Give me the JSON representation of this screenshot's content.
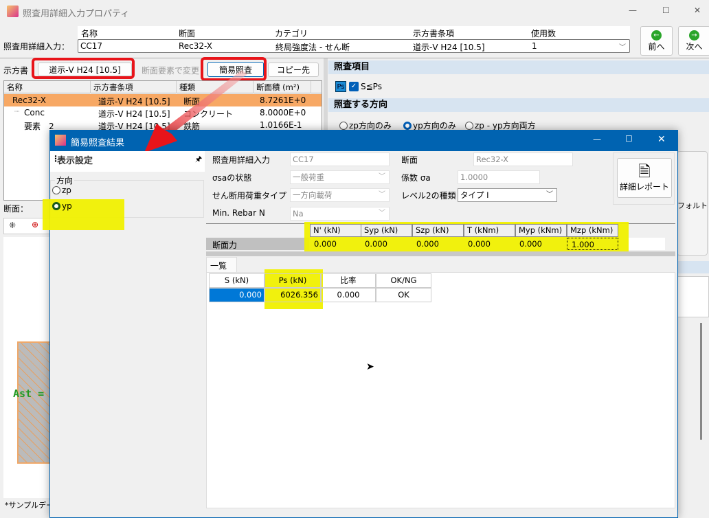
{
  "window": {
    "title": "照査用詳細入力プロパティ",
    "min": "—",
    "max": "☐",
    "close": "✕"
  },
  "header": {
    "label": "照査用詳細入力：",
    "columns": [
      "名称",
      "断面",
      "カテゴリ",
      "示方書条項",
      "使用数"
    ],
    "values": [
      "CC17",
      "Rec32-X",
      "終局強度法 - せん断",
      "道示-V H24 [10.5]",
      "1"
    ],
    "prev": "前へ",
    "next": "次へ"
  },
  "left": {
    "code_label": "示方書",
    "code_button": "道示-V H24 [10.5]",
    "change_label": "断面要素で変更",
    "simple_check": "簡易照査",
    "copy_to": "コピー先",
    "tree_columns": [
      "名称",
      "示方書条項",
      "種類",
      "断面積 (m²)"
    ],
    "tree_rows": [
      [
        "Rec32-X",
        "道示-V H24 [10.5]",
        "断面",
        "8.7261E+0"
      ],
      [
        "Conc",
        "道示-V H24 [10.5]",
        "コンクリート",
        "8.0000E+0"
      ],
      [
        "要素　2",
        "道示-V H24 [10.5]",
        "鉄筋",
        "1.0166E-1"
      ]
    ],
    "section_label": "断面：",
    "ast": "Ast =",
    "status": "*サンプルデータ"
  },
  "right": {
    "check_items": "照査項目",
    "ps_icon": "Ps",
    "ps_check": "S≦Ps",
    "direction": "照査する方向",
    "dir_options": [
      "zp方向のみ",
      "yp方向のみ",
      "zp - yp方向両方"
    ],
    "default_text": "フォルト"
  },
  "dialog": {
    "title": "簡易照査結果",
    "min": "—",
    "max": "☐",
    "close": "✕",
    "display_settings": "表示設定",
    "pin": "🖈",
    "direction_group": "方向",
    "dir_options": [
      "zp",
      "yp"
    ],
    "fields": {
      "detail_label": "照査用詳細入力",
      "detail_value": "CC17",
      "section_label": "断面",
      "section_value": "Rec32-X",
      "sigma_label": "σsaの状態",
      "sigma_value": "一般荷重",
      "coef_label": "係数 σa",
      "coef_value": "1.0000",
      "shear_label": "せん断用荷重タイプ",
      "shear_value": "一方向載荷",
      "level2_label": "レベル2の種類",
      "level2_value": "タイプ I",
      "minrebar_label": "Min. Rebar N",
      "minrebar_value": "Na"
    },
    "report_button": "詳細レポート",
    "force_columns": [
      "N' (kN)",
      "Syp (kN)",
      "Szp (kN)",
      "T (kNm)",
      "Myp (kNm)",
      "Mzp (kNm)"
    ],
    "force_row_label": "断面力",
    "force_values": [
      "0.000",
      "0.000",
      "0.000",
      "0.000",
      "0.000",
      "1.000"
    ],
    "tab": "一覧",
    "result_columns": [
      "S (kN)",
      "Ps (kN)",
      "比率",
      "OK/NG"
    ],
    "result_values": [
      "0.000",
      "6026.356",
      "0.000",
      "OK"
    ]
  }
}
